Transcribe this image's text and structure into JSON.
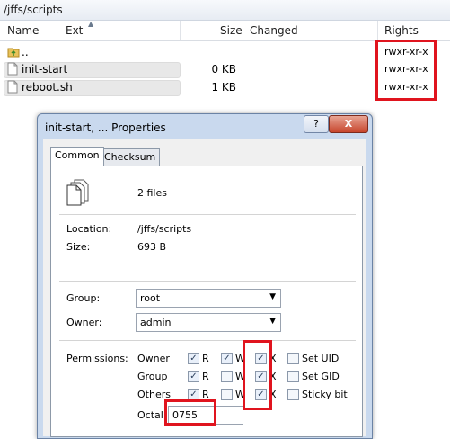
{
  "path": "/jffs/scripts",
  "columns": {
    "name": "Name",
    "ext": "Ext",
    "size": "Size",
    "changed": "Changed",
    "rights": "Rights"
  },
  "files": [
    {
      "name": "..",
      "size": "",
      "rights": "rwxr-xr-x",
      "icon": "folder-up-icon"
    },
    {
      "name": "init-start",
      "size": "0 KB",
      "rights": "rwxr-xr-x",
      "icon": "file-icon"
    },
    {
      "name": "reboot.sh",
      "size": "1 KB",
      "rights": "rwxr-xr-x",
      "icon": "file-icon"
    }
  ],
  "dialog": {
    "title": "init-start, ... Properties",
    "help_button": "?",
    "close_button": "X",
    "tabs": [
      "Common",
      "Checksum"
    ],
    "file_count": "2 files",
    "location_label": "Location:",
    "location_value": "/jffs/scripts",
    "size_label": "Size:",
    "size_value": "693 B",
    "group_label": "Group:",
    "group_value": "root",
    "owner_label": "Owner:",
    "owner_value": "admin",
    "permissions_label": "Permissions:",
    "perm_rows": [
      {
        "label": "Owner",
        "r": true,
        "w": true,
        "x": true,
        "special": "Set UID",
        "special_checked": false
      },
      {
        "label": "Group",
        "r": true,
        "w": false,
        "x": true,
        "special": "Set GID",
        "special_checked": false
      },
      {
        "label": "Others",
        "r": true,
        "w": false,
        "x": true,
        "special": "Sticky bit",
        "special_checked": false
      }
    ],
    "perm_letters": {
      "r": "R",
      "w": "W",
      "x": "X"
    },
    "octal_label": "Octal:",
    "octal_value": "0755"
  },
  "colors": {
    "highlight": "#e0141e",
    "accent": "#2b3f5c"
  }
}
